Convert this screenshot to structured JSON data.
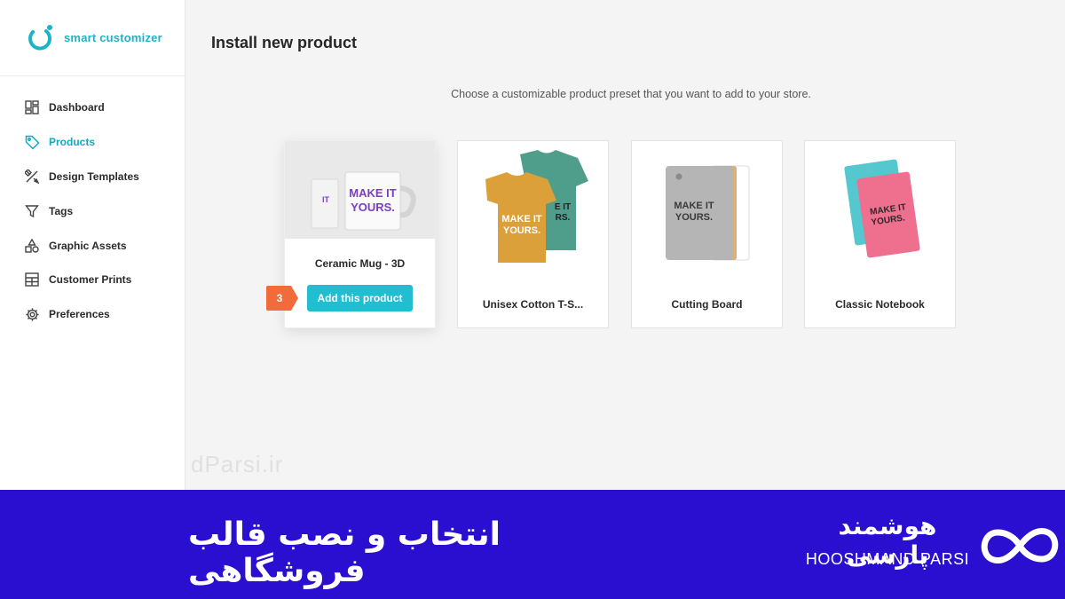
{
  "brand": {
    "name": "smart customizer",
    "color": "#1cb3c8"
  },
  "sidebar": {
    "items": [
      {
        "label": "Dashboard",
        "icon": "dashboard-icon",
        "active": false
      },
      {
        "label": "Products",
        "icon": "tag-icon",
        "active": true
      },
      {
        "label": "Design Templates",
        "icon": "design-tools-icon",
        "active": false
      },
      {
        "label": "Tags",
        "icon": "filter-icon",
        "active": false
      },
      {
        "label": "Graphic Assets",
        "icon": "shapes-icon",
        "active": false
      },
      {
        "label": "Customer Prints",
        "icon": "prints-icon",
        "active": false
      },
      {
        "label": "Preferences",
        "icon": "gear-icon",
        "active": false
      }
    ]
  },
  "main": {
    "title": "Install new product",
    "subtitle": "Choose a customizable product preset that you want to add to your store.",
    "products": [
      {
        "name": "Ceramic Mug - 3D",
        "image": "mug-image",
        "action_label": "Add this product"
      },
      {
        "name": "Unisex Cotton T-S...",
        "image": "tshirt-image"
      },
      {
        "name": "Cutting Board",
        "image": "cutting-board-image"
      },
      {
        "name": "Classic Notebook",
        "image": "notebook-image"
      }
    ],
    "mockup_text": [
      "MAKE IT",
      "YOURS."
    ],
    "step_badge": "3"
  },
  "watermark": "dParsi.ir",
  "banner": {
    "headline": "انتخاب و نصب قالب فروشگاهی",
    "brand_fa": "هوشمند پارسی",
    "brand_en": "HOOSHMAND PARSI",
    "background": "#2a0fd0"
  },
  "colors": {
    "accent": "#22bdd0",
    "badge": "#f26b3a",
    "active_nav": "#12a9be"
  }
}
